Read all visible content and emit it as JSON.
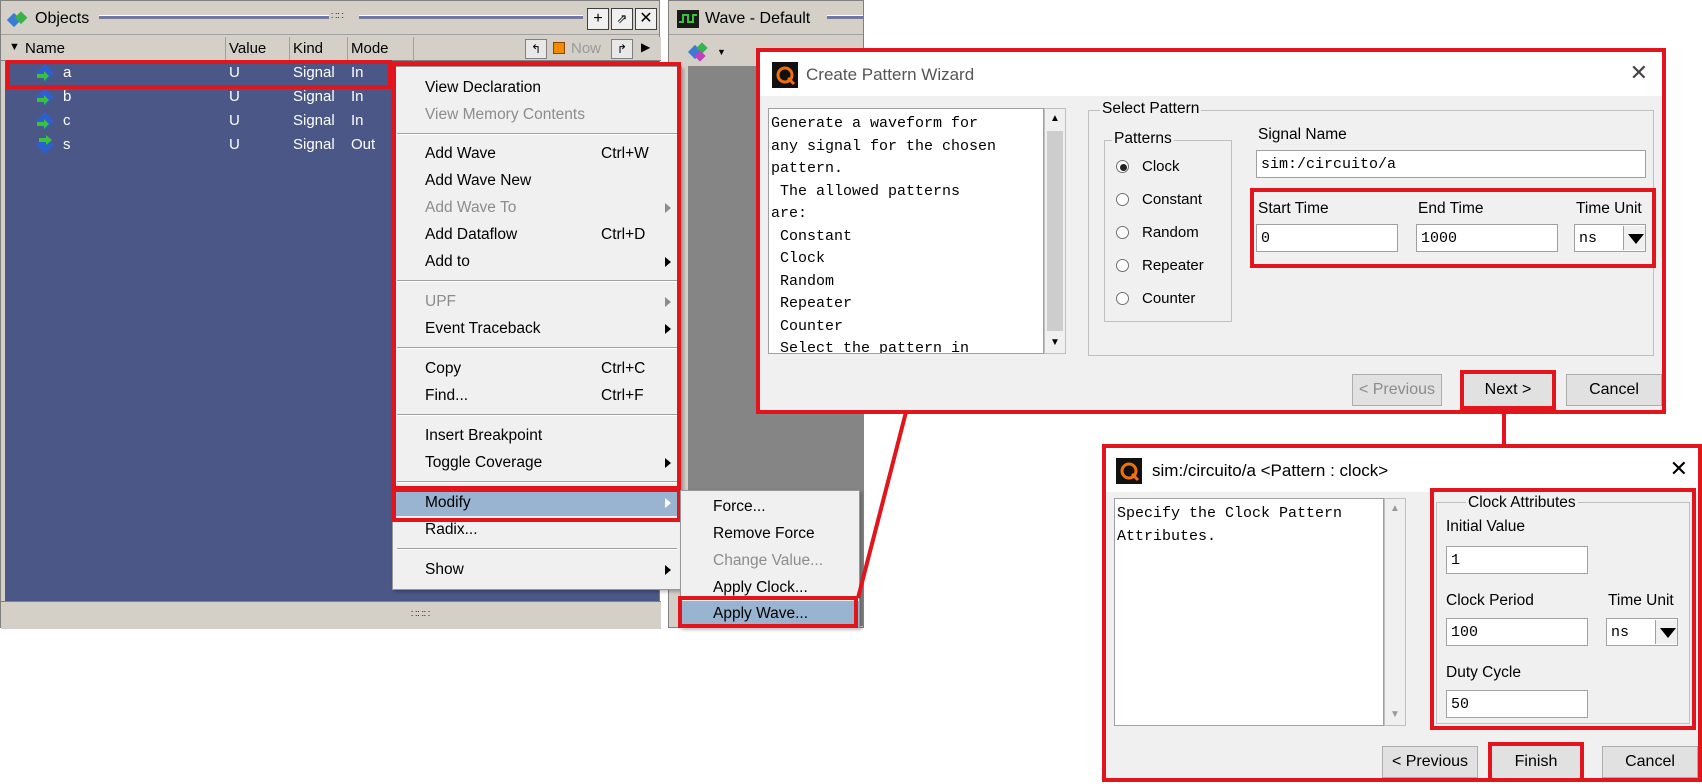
{
  "objects_panel": {
    "title": "Objects",
    "columns": [
      "Name",
      "Value",
      "Kind",
      "Mode"
    ],
    "now_label": "Now",
    "rows": [
      {
        "name": "a",
        "value": "U",
        "kind": "Signal",
        "mode": "In"
      },
      {
        "name": "b",
        "value": "U",
        "kind": "Signal",
        "mode": "In"
      },
      {
        "name": "c",
        "value": "U",
        "kind": "Signal",
        "mode": "In"
      },
      {
        "name": "s",
        "value": "U",
        "kind": "Signal",
        "mode": "Out"
      }
    ]
  },
  "wave_panel": {
    "title": "Wave - Default"
  },
  "context_menu": {
    "items": [
      {
        "label": "View Declaration",
        "shortcut": "",
        "submenu": false,
        "disabled": false
      },
      {
        "label": "View Memory Contents",
        "shortcut": "",
        "submenu": false,
        "disabled": true
      },
      {
        "label": "Add Wave",
        "shortcut": "Ctrl+W",
        "submenu": false,
        "disabled": false
      },
      {
        "label": "Add Wave New",
        "shortcut": "",
        "submenu": false,
        "disabled": false
      },
      {
        "label": "Add Wave To",
        "shortcut": "",
        "submenu": true,
        "disabled": true
      },
      {
        "label": "Add Dataflow",
        "shortcut": "Ctrl+D",
        "submenu": false,
        "disabled": false
      },
      {
        "label": "Add to",
        "shortcut": "",
        "submenu": true,
        "disabled": false
      },
      {
        "label": "UPF",
        "shortcut": "",
        "submenu": true,
        "disabled": true
      },
      {
        "label": "Event Traceback",
        "shortcut": "",
        "submenu": true,
        "disabled": false
      },
      {
        "label": "Copy",
        "shortcut": "Ctrl+C",
        "submenu": false,
        "disabled": false
      },
      {
        "label": "Find...",
        "shortcut": "Ctrl+F",
        "submenu": false,
        "disabled": false
      },
      {
        "label": "Insert Breakpoint",
        "shortcut": "",
        "submenu": false,
        "disabled": false
      },
      {
        "label": "Toggle Coverage",
        "shortcut": "",
        "submenu": true,
        "disabled": false
      },
      {
        "label": "Modify",
        "shortcut": "",
        "submenu": true,
        "disabled": false
      },
      {
        "label": "Radix...",
        "shortcut": "",
        "submenu": false,
        "disabled": false
      },
      {
        "label": "Show",
        "shortcut": "",
        "submenu": true,
        "disabled": false
      }
    ]
  },
  "modify_submenu": {
    "items": [
      {
        "label": "Force...",
        "disabled": false
      },
      {
        "label": "Remove Force",
        "disabled": false
      },
      {
        "label": "Change Value...",
        "disabled": true
      },
      {
        "label": "Apply Clock...",
        "disabled": false
      },
      {
        "label": "Apply Wave...",
        "disabled": false
      }
    ]
  },
  "wizard": {
    "title": "Create Pattern Wizard",
    "description": "Generate a waveform for\nany signal for the chosen\npattern.\n The allowed patterns\nare:\n Constant\n Clock\n Random\n Repeater\n Counter\n Select the pattern in",
    "select_pattern_label": "Select Pattern",
    "patterns_label": "Patterns",
    "patterns": [
      "Clock",
      "Constant",
      "Random",
      "Repeater",
      "Counter"
    ],
    "selected_pattern": "Clock",
    "signal_name_label": "Signal Name",
    "signal_name": "sim:/circuito/a",
    "start_time_label": "Start Time",
    "start_time": "0",
    "end_time_label": "End Time",
    "end_time": "1000",
    "time_unit_label": "Time Unit",
    "time_unit": "ns",
    "prev_label": "< Previous",
    "next_label": "Next >",
    "cancel_label": "Cancel"
  },
  "clock_dialog": {
    "title": "sim:/circuito/a <Pattern : clock>",
    "description": "Specify the Clock Pattern\nAttributes.",
    "group_label": "Clock Attributes",
    "initial_value_label": "Initial Value",
    "initial_value": "1",
    "clock_period_label": "Clock Period",
    "clock_period": "100",
    "time_unit_label": "Time Unit",
    "time_unit": "ns",
    "duty_cycle_label": "Duty Cycle",
    "duty_cycle": "50",
    "prev_label": "< Previous",
    "finish_label": "Finish",
    "cancel_label": "Cancel"
  },
  "colors": {
    "highlight_red": "#e3151c",
    "list_bg": "#4a5787",
    "menu_hover": "#99b4d1"
  }
}
